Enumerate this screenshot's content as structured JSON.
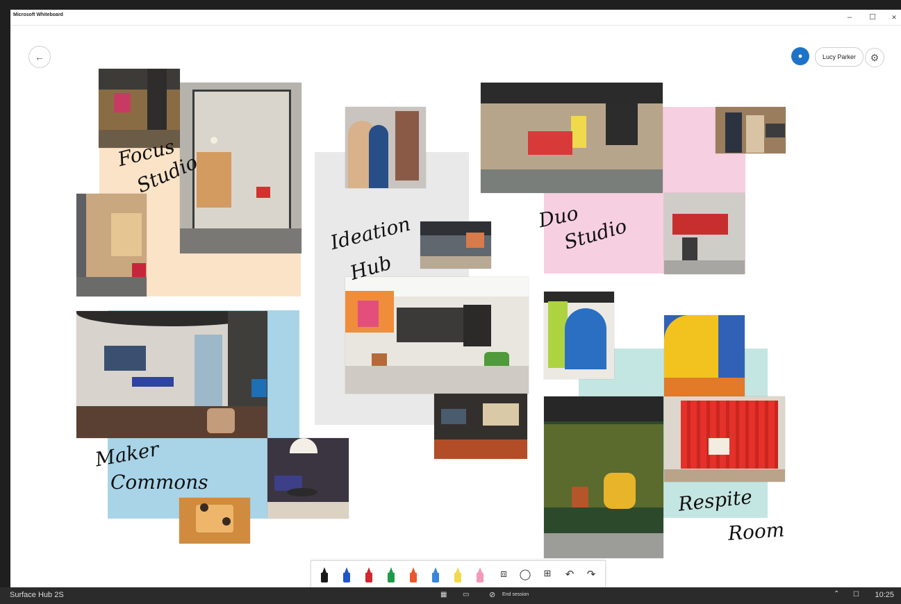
{
  "window": {
    "title": "Microsoft Whiteboard",
    "minimize_glyph": "–",
    "maximize_glyph": "☐",
    "close_glyph": "✕"
  },
  "header": {
    "back_glyph": "←",
    "user_initial": "⎇",
    "user_name": "Lucy Parker",
    "settings_glyph": "⚙"
  },
  "board_labels": {
    "focus_1": "Focus",
    "focus_2": "Studio",
    "ideation_1": "Ideation",
    "ideation_2": "Hub",
    "duo_1": "Duo",
    "duo_2": "Studio",
    "maker_1": "Maker",
    "maker_2": "Commons",
    "respite_1": "Respite",
    "respite_2": "Room"
  },
  "colors": {
    "peach": "#fbe3c7",
    "gray": "#e9e9e9",
    "pink": "#f6cfe1",
    "blue": "#a9d4e8",
    "mint": "#c4e6e2",
    "accent": "#1e73c9"
  },
  "toolbar": {
    "pens": [
      {
        "name": "black-pen-icon",
        "color": "#1a1a1a"
      },
      {
        "name": "blue-pen-icon",
        "color": "#2056c7"
      },
      {
        "name": "red-pen-icon",
        "color": "#d0282e"
      },
      {
        "name": "green-pen-icon",
        "color": "#1f9a4a"
      },
      {
        "name": "orange-pen-icon",
        "color": "#e8582c"
      },
      {
        "name": "lightblue-pen-icon",
        "color": "#3a86d8"
      },
      {
        "name": "yellow-highlighter-icon",
        "color": "#f2d84b"
      },
      {
        "name": "pink-highlighter-icon",
        "color": "#f39ab8"
      }
    ],
    "ruler_glyph": "⧈",
    "lasso_glyph": "◯",
    "add_glyph": "⊞",
    "undo_glyph": "↶",
    "redo_glyph": "↷"
  },
  "taskbar": {
    "device_name": "Surface Hub 2S",
    "windows_glyph": "▦",
    "camera_glyph": "▭",
    "end_session_glyph": "⊘",
    "end_session_label": "End session",
    "tray_up_glyph": "⌃",
    "tray_notify_glyph": "☐",
    "time": "10:25"
  }
}
